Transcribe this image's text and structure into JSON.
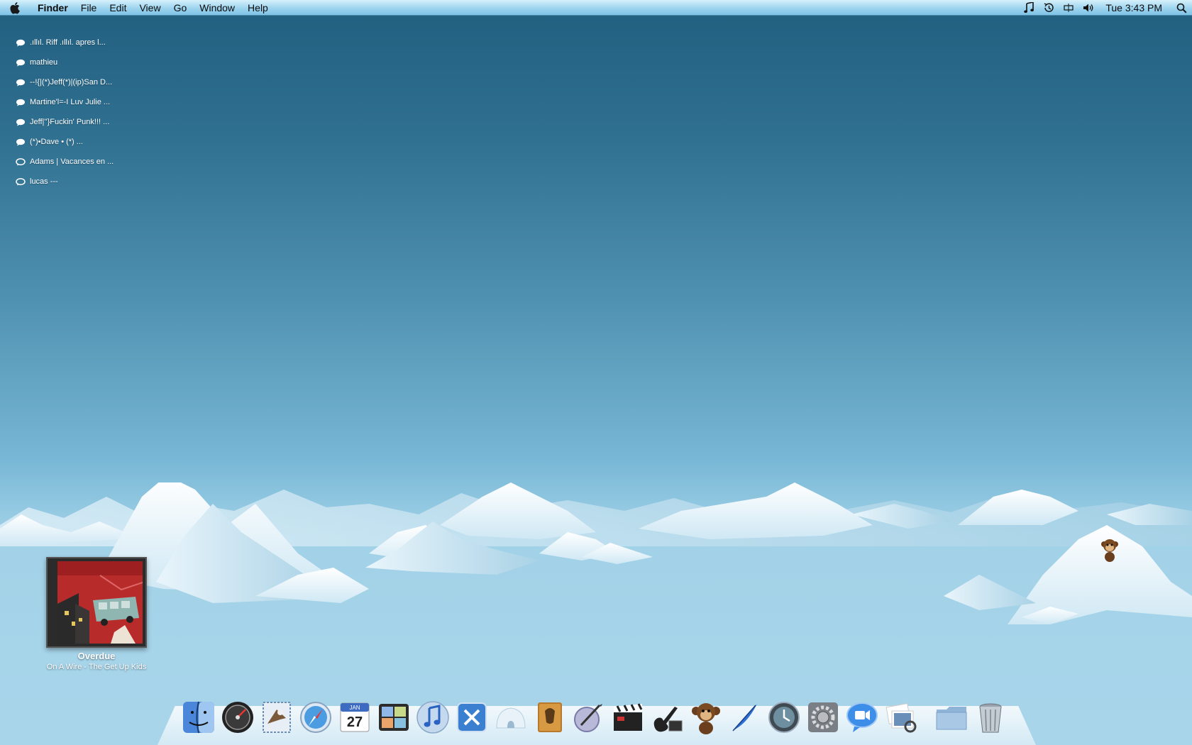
{
  "menubar": {
    "apple_icon": "apple-icon",
    "app_name": "Finder",
    "menus": [
      "File",
      "Edit",
      "View",
      "Go",
      "Window",
      "Help"
    ],
    "status_icons": [
      "music-note-icon",
      "time-machine-icon",
      "display-icon",
      "volume-icon"
    ],
    "clock": "Tue 3:43 PM",
    "spotlight_icon": "spotlight-icon"
  },
  "buddies": [
    ".ıllıl. Riff .ıllıl. apres l...",
    "mathieu",
    "--!{|(*)Jeff(*)|(ip)San D...",
    "Martine'l=-I Luv Julie ...",
    "Jeff|''}Fuckin' Punk!!! ...",
    "(*)•Dave  • (*)            ...",
    "Adams | Vacances en ...",
    "lucas ---"
  ],
  "now_playing": {
    "title": "Overdue",
    "subtitle": "On A Wire - The Get Up Kids"
  },
  "dock": {
    "apps": [
      "finder-icon",
      "dashboard-icon",
      "mail-icon",
      "safari-icon",
      "ical-icon",
      "spaces-icon",
      "itunes-icon",
      "xcode-icon",
      "igloo-icon",
      "evernote-icon",
      "script-editor-icon",
      "imovie-icon",
      "garageband-icon",
      "monkey-icon",
      "feather-icon",
      "time-machine-icon",
      "system-preferences-icon",
      "facetime-icon",
      "preview-icon"
    ],
    "ical_month": "JAN",
    "ical_day": "27",
    "stack_icons": [
      "downloads-folder-icon",
      "trash-icon"
    ]
  },
  "colors": {
    "sky_top": "#215f7f",
    "sky_bottom": "#a9d5ea",
    "menubar": "#9dd4ee",
    "ice": "#ffffff"
  }
}
